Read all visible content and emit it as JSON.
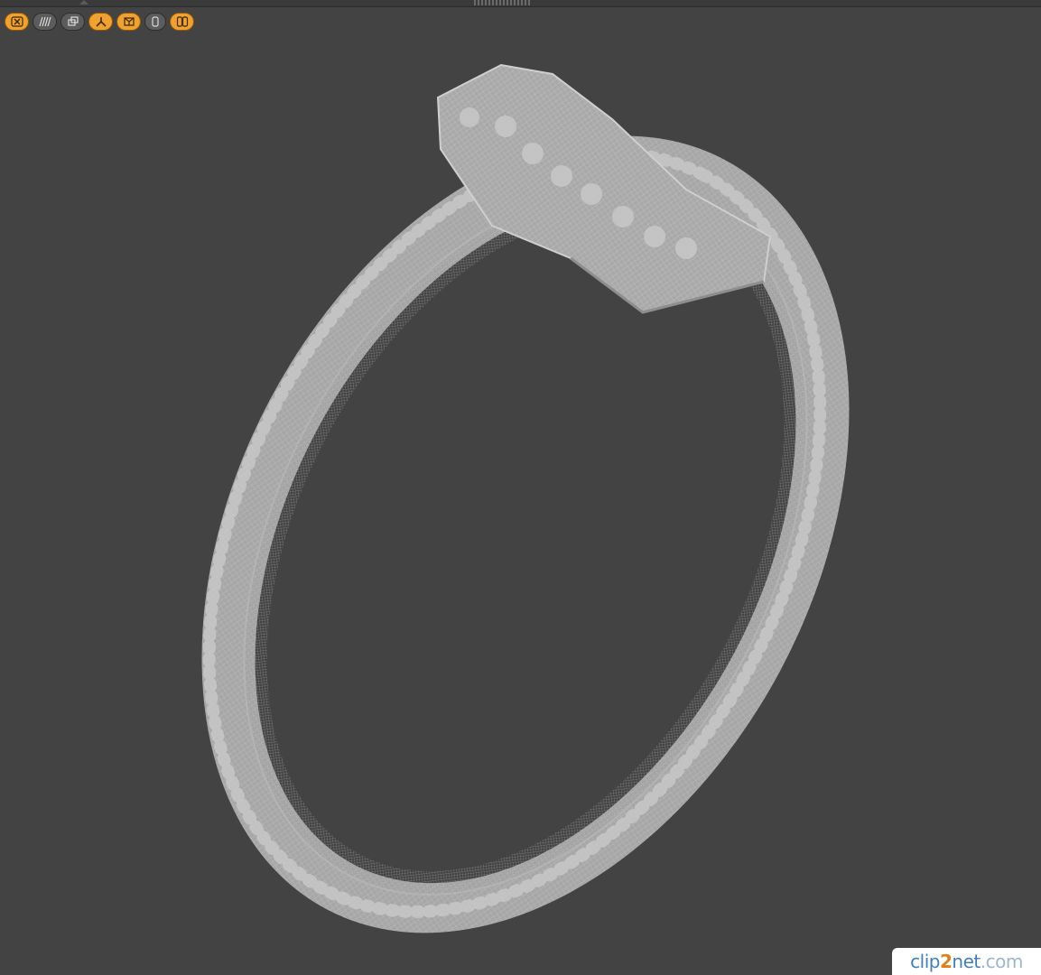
{
  "viewport": {
    "background": "#434343",
    "mesh_color": "#b0b0b0"
  },
  "toolbar": {
    "buttons": [
      {
        "icon": "close-x-icon",
        "active": true
      },
      {
        "icon": "wireframe-lines-icon",
        "active": false
      },
      {
        "icon": "frame-view-icon",
        "active": false
      },
      {
        "icon": "axis-tripod-icon",
        "active": true
      },
      {
        "icon": "perspective-box-icon",
        "active": true
      },
      {
        "icon": "single-pane-icon",
        "active": false
      },
      {
        "icon": "dual-pane-icon",
        "active": true
      }
    ],
    "active_color": "#f1a22e",
    "inactive_color": "#5c5c5c"
  },
  "watermark": {
    "part1": "clip",
    "part2": "2",
    "part3": "net",
    "part4": ".com"
  }
}
